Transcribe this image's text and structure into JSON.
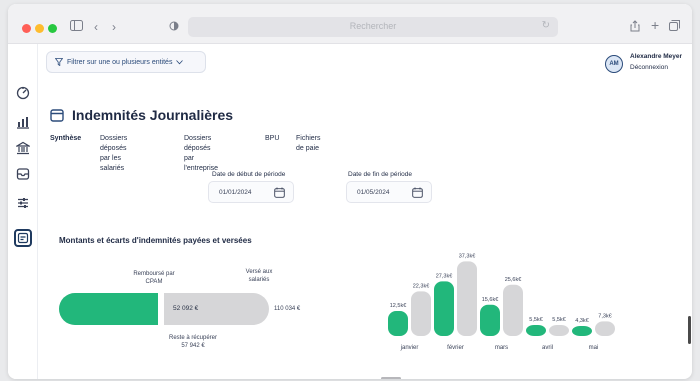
{
  "browser": {
    "url_placeholder": "Rechercher",
    "colors": {
      "red": "#ff5f57",
      "yellow": "#febc2e",
      "green": "#28c840"
    },
    "icons": [
      "sidebar-toggle-icon",
      "back-icon",
      "forward-icon",
      "privacy-icon",
      "reload-icon",
      "share-icon",
      "new-tab-icon",
      "tabs-overview-icon"
    ]
  },
  "header": {
    "filter_label": "Filtrer sur une ou plusieurs entités",
    "user": {
      "initials": "AM",
      "name": "Alexandre Meyer",
      "logout": "Déconnexion"
    }
  },
  "sidebar": {
    "items": [
      {
        "icon": "dashboard-gauge-icon"
      },
      {
        "icon": "analytics-chart-icon"
      },
      {
        "icon": "institution-icon"
      },
      {
        "icon": "inbox-icon"
      },
      {
        "icon": "settings-sliders-icon"
      },
      {
        "icon": "indemnities-icon",
        "active": true
      }
    ]
  },
  "main": {
    "title": "Indemnités Journalières",
    "tabs": [
      {
        "label": "Synthèse",
        "active": true
      },
      {
        "label_line1": "Dossiers déposés",
        "label_line2": "par les salariés"
      },
      {
        "label_line1": "Dossiers déposés",
        "label_line2": "par l'entreprise"
      },
      {
        "label": "BPU"
      },
      {
        "label": "Fichiers de paie"
      }
    ],
    "start_date": {
      "label": "Date de début de période",
      "value": "01/01/2024"
    },
    "end_date": {
      "label": "Date de fin de période",
      "value": "01/05/2024"
    }
  },
  "section": {
    "title": "Montants et écarts d'indemnités payées et versées",
    "progress": {
      "reimbursed_label_line1": "Remboursé par",
      "reimbursed_label_line2": "CPAM",
      "paid_label_line1": "Versé aux",
      "paid_label_line2": "salariés",
      "reimbursed_value": "52 092 €",
      "total_value": "110 034 €",
      "remaining_label": "Reste à récupérer",
      "remaining_value": "57 942 €",
      "reimbursed_fraction": 0.473
    }
  },
  "chart_data": {
    "type": "bar",
    "categories": [
      "janvier",
      "février",
      "mars",
      "avril",
      "mai"
    ],
    "series": [
      {
        "values": [
          12.5,
          27.3,
          15.6,
          5.5,
          4.3
        ],
        "color": "#22b77b"
      },
      {
        "values": [
          22.3,
          37.3,
          25.6,
          5.5,
          7.3
        ],
        "color": "#d6d6d8"
      }
    ],
    "labels_green": [
      "12,5k€",
      "27,3k€",
      "15,6k€",
      "5,5k€",
      "4,3k€"
    ],
    "labels_gray": [
      "22,3k€",
      "37,3k€",
      "25,6k€",
      "5,5k€",
      "7,3k€"
    ],
    "ylim": [
      0,
      40
    ],
    "grid": false,
    "title": "",
    "xlabel": "",
    "ylabel": ""
  }
}
